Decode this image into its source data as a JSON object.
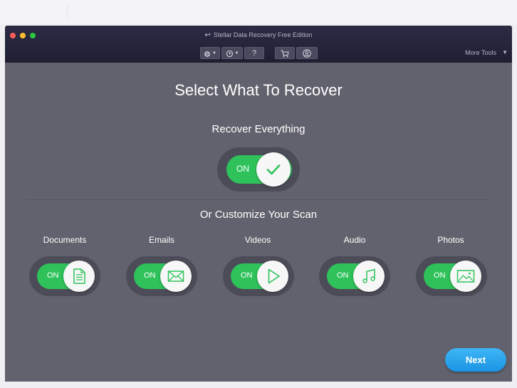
{
  "window": {
    "title": "Stellar Data Recovery Free Edition"
  },
  "toolbar": {
    "settings_icon": "gear-icon",
    "history_icon": "history-icon",
    "help_label": "?",
    "cart_icon": "cart-icon",
    "account_icon": "user-icon",
    "more_tools": "More Tools"
  },
  "main": {
    "title": "Select What To Recover",
    "recover_everything": {
      "label": "Recover Everything",
      "state": "ON",
      "icon": "checkmark-icon"
    },
    "customize_title": "Or Customize Your Scan",
    "categories": [
      {
        "label": "Documents",
        "state": "ON",
        "icon": "document-icon"
      },
      {
        "label": "Emails",
        "state": "ON",
        "icon": "envelope-icon"
      },
      {
        "label": "Videos",
        "state": "ON",
        "icon": "play-icon"
      },
      {
        "label": "Audio",
        "state": "ON",
        "icon": "music-note-icon"
      },
      {
        "label": "Photos",
        "state": "ON",
        "icon": "image-icon"
      }
    ],
    "next_label": "Next"
  },
  "colors": {
    "accent_green": "#2fc25a",
    "next_blue": "#1a95e4",
    "background": "#62626e",
    "titlebar": "#25253a"
  }
}
